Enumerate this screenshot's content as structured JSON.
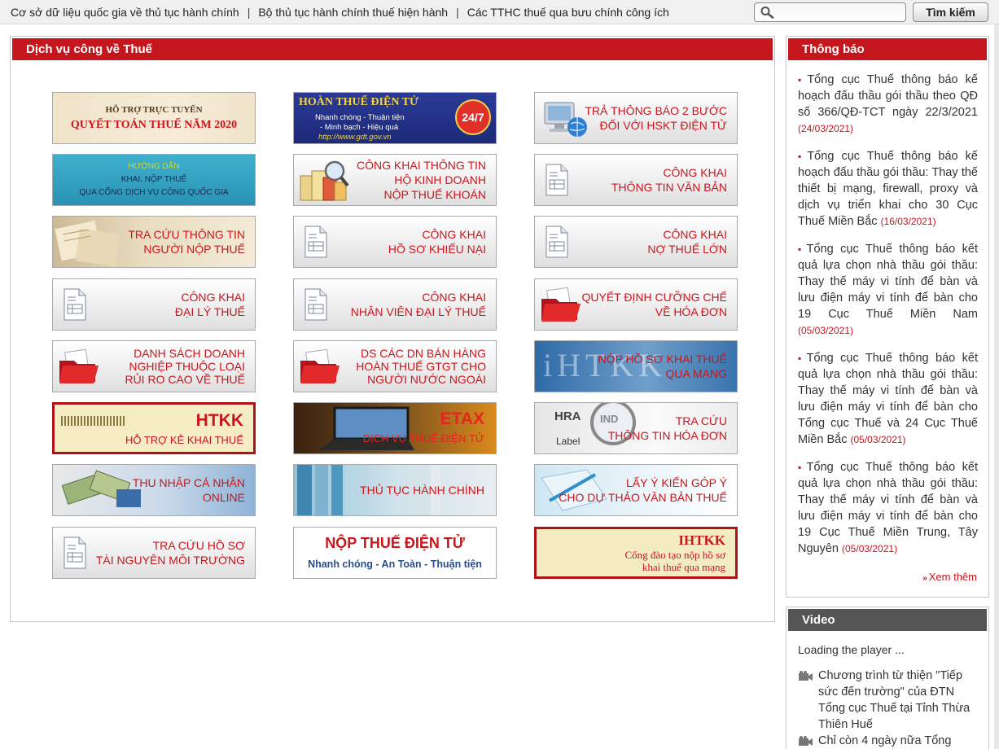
{
  "topnav": {
    "links": [
      "Cơ sở dữ liệu quốc gia về thủ tục hành chính",
      "Bộ thủ tục hành chính thuế hiện hành",
      "Các TTHC thuế qua bưu chính công ích"
    ],
    "separator": "|",
    "search_placeholder": "",
    "search_button": "Tìm kiếm"
  },
  "main": {
    "title": "Dịch vụ công về Thuế",
    "tiles": [
      {
        "id": "quyet-toan-2020",
        "lines": [
          "HỖ TRỢ TRỰC TUYẾN",
          "QUYẾT TOÁN THUẾ NĂM 2020"
        ]
      },
      {
        "id": "hoan-thue-dien-tu",
        "lines": [
          "HOÀN THUẾ ĐIỆN TỬ",
          "Nhanh chóng - Thuận tiện",
          "- Minh bạch - Hiệu quả",
          "http://www.gdt.gov.vn"
        ],
        "badge": "24/7"
      },
      {
        "id": "tra-thong-bao-2-buoc",
        "lines": [
          "TRẢ THÔNG BÁO 2 BƯỚC",
          "ĐỐI VỚI HSKT ĐIỆN TỬ"
        ]
      },
      {
        "id": "huong-dan-khai-nop",
        "lines": [
          "HƯỚNG DẪN",
          "KHAI, NỘP THUẾ",
          "QUA CỔNG DỊCH VỤ CÔNG QUỐC GIA"
        ]
      },
      {
        "id": "cong-khai-hkd",
        "lines": [
          "CÔNG KHAI THÔNG TIN",
          "HỘ KINH DOANH",
          "NỘP THUẾ KHOÁN"
        ]
      },
      {
        "id": "cong-khai-van-ban",
        "lines": [
          "CÔNG KHAI",
          "THÔNG TIN VĂN BẢN"
        ]
      },
      {
        "id": "tra-cuu-nnt",
        "lines": [
          "TRA CỨU THÔNG TIN",
          "NGƯỜI NỘP THUẾ"
        ]
      },
      {
        "id": "ho-so-khieu-nai",
        "lines": [
          "CÔNG KHAI",
          "HỒ SƠ KHIẾU NẠI"
        ]
      },
      {
        "id": "no-thue-lon",
        "lines": [
          "CÔNG KHAI",
          "NỢ THUẾ LỚN"
        ]
      },
      {
        "id": "dai-ly-thue",
        "lines": [
          "CÔNG KHAI",
          "ĐẠI LÝ THUẾ"
        ]
      },
      {
        "id": "nhan-vien-dai-ly",
        "lines": [
          "CÔNG KHAI",
          "NHÂN VIÊN ĐẠI LÝ THUẾ"
        ]
      },
      {
        "id": "cuong-che-hoa-don",
        "lines": [
          "QUYẾT ĐỊNH CƯỠNG CHẾ",
          "VỀ HÓA ĐƠN"
        ]
      },
      {
        "id": "dn-rui-ro-cao",
        "lines": [
          "DANH SÁCH DOANH",
          "NGHIỆP THUỘC LOẠI",
          "RỦI RO CAO VỀ THUẾ"
        ]
      },
      {
        "id": "hoan-thue-gtgt",
        "lines": [
          "DS CÁC DN BÁN HÀNG",
          "HOÀN THUẾ GTGT CHO",
          "NGƯỜI NƯỚC NGOÀI"
        ]
      },
      {
        "id": "ihtkk-nop-ho-so",
        "lines": [
          "NỘP HỒ SƠ KHAI THUẾ",
          "QUA MẠNG"
        ],
        "watermark": "iHTKK"
      },
      {
        "id": "htkk",
        "lines": [
          "HTKK",
          "HỖ TRỢ KÊ KHAI THUẾ"
        ]
      },
      {
        "id": "etax",
        "lines": [
          "ETAX",
          "DỊCH VỤ THUẾ ĐIỆN TỬ"
        ]
      },
      {
        "id": "tra-cuu-hoa-don",
        "lines": [
          "TRA CỨU",
          "THÔNG TIN HÓA ĐƠN"
        ],
        "photo_text": [
          "HRA",
          "IND",
          "Label"
        ]
      },
      {
        "id": "tncn-online",
        "lines": [
          "THU NHẬP CÁ NHÂN",
          "ONLINE"
        ]
      },
      {
        "id": "thu-tuc-hanh-chinh",
        "lines": [
          "THỦ TỤC HÀNH CHÍNH"
        ]
      },
      {
        "id": "lay-y-kien",
        "lines": [
          "LẤY Ý KIẾN GÓP Ý",
          "CHO DỰ THẢO VĂN BẢN THUẾ"
        ]
      },
      {
        "id": "tai-nguyen-moi-truong",
        "lines": [
          "TRA CỨU HỒ SƠ",
          "TÀI NGUYÊN MÔI TRƯỜNG"
        ]
      },
      {
        "id": "nop-thue-dien-tu",
        "lines": [
          "NỘP THUẾ ĐIỆN TỬ",
          "Nhanh chóng - An Toàn - Thuận tiện"
        ]
      },
      {
        "id": "ihtkk-dao-tao",
        "lines": [
          "IHTKK",
          "Cổng đào tạo nộp hồ sơ",
          "khai thuế qua mạng"
        ]
      }
    ]
  },
  "notice": {
    "title": "Thông báo",
    "items": [
      {
        "text": "Tổng cục Thuế thông báo kế hoạch đấu thầu gói thầu theo QĐ số 366/QĐ-TCT ngày 22/3/2021",
        "date": "(24/03/2021)"
      },
      {
        "text": "Tổng cục Thuế thông báo kế hoạch đấu thầu gói thầu: Thay thế thiết bị mạng, firewall, proxy và dịch vụ triển khai cho 30 Cục Thuế Miền Bắc",
        "date": "(16/03/2021)"
      },
      {
        "text": "Tổng cục Thuế thông báo kết quả lựa chọn nhà thầu gói thầu: Thay thế máy vi tính để bàn và lưu điện máy vi tính để bàn cho 19 Cục Thuế Miền Nam",
        "date": "(05/03/2021)"
      },
      {
        "text": "Tổng cục Thuế thông báo kết quả lựa chọn nhà thầu gói thầu: Thay thế máy vi tính để bàn và lưu điện máy vi tính để bàn cho Tổng cục Thuế và 24 Cục Thuế Miền Bắc",
        "date": "(05/03/2021)"
      },
      {
        "text": "Tổng cục Thuế thông báo kết quả lựa chọn nhà thầu gói thầu: Thay thế máy vi tính để bàn và lưu điện máy vi tính để bàn cho 19 Cục Thuế Miền Trung, Tây Nguyên",
        "date": "(05/03/2021)"
      }
    ],
    "more": "Xem thêm"
  },
  "video": {
    "title": "Video",
    "loading": "Loading the player ...",
    "items": [
      "Chương trình từ thiện \"Tiếp sức đến trường\" của ĐTN Tổng cục Thuế tại Tỉnh Thừa Thiên Huế",
      "Chỉ còn 4 ngày nữa Tổng"
    ]
  },
  "colors": {
    "brand_red": "#c5161d",
    "video_header": "#555555",
    "link_text": "#222222"
  }
}
